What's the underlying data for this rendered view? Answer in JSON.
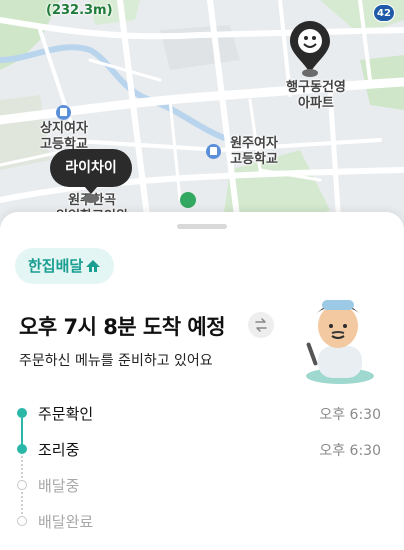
{
  "map": {
    "distance": "(232.3m)",
    "route_number": "42",
    "labels": {
      "apartment": "행구동건영\n아파트",
      "school_1": "상지여자\n고등학교",
      "school_2": "원주여자\n고등학교",
      "partial_place": "원주한곡\n임업학교인원"
    },
    "rider_name": "라이차이",
    "store_icon": "store-logo-icon"
  },
  "sheet": {
    "badge": "한집배달",
    "eta_title": "오후 7시 8분 도착 예정",
    "eta_subtitle": "주문하신 메뉴를 준비하고 있어요",
    "steps": [
      {
        "label": "주문확인",
        "time": "오후 6:30",
        "state": "done"
      },
      {
        "label": "조리중",
        "time": "오후 6:30",
        "state": "done"
      },
      {
        "label": "배달중",
        "time": "",
        "state": "todo"
      },
      {
        "label": "배달완료",
        "time": "",
        "state": "todo"
      }
    ],
    "colors": {
      "accent": "#2bb7a8",
      "badge_bg": "#e3f6f3"
    }
  }
}
